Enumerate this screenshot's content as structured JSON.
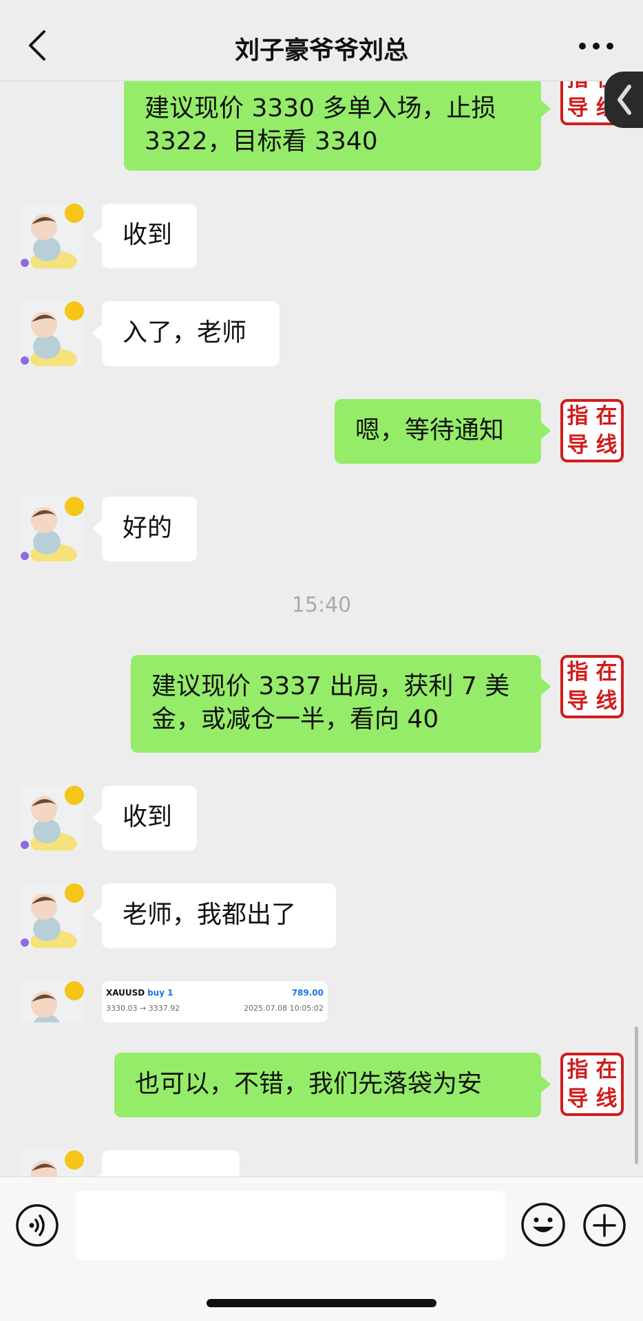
{
  "header": {
    "title": "刘子豪爷爷刘总",
    "back_icon": "chevron-left-icon",
    "more_icon": "ellipsis-icon"
  },
  "stamp": {
    "chars": [
      "指",
      "在",
      "导",
      "线"
    ],
    "color": "#d21a1a"
  },
  "messages": [
    {
      "side": "out",
      "text": "建议现价 3330 多单入场，止损 3322，目标看 3340"
    },
    {
      "side": "in",
      "text": "收到"
    },
    {
      "side": "in",
      "text": "入了，老师"
    },
    {
      "side": "out",
      "text": "嗯，等待通知"
    },
    {
      "side": "in",
      "text": "好的"
    },
    {
      "side": "out",
      "text": "建议现价 3337 出局，获利 7 美金，或减仓一半，看向 40"
    },
    {
      "side": "in",
      "text": "收到"
    },
    {
      "side": "in",
      "text": "老师，我都出了"
    },
    {
      "side": "out",
      "text": "也可以，不错，我们先落袋为安"
    }
  ],
  "timestamp": "15:40",
  "trade_card": {
    "symbol": "XAUUSD",
    "side": "buy 1",
    "profit": "789.00",
    "prices": "3330.03 → 3337.92",
    "datetime": "2025.07.08 10:05:02"
  },
  "bottom_bar": {
    "voice_icon": "voice-icon",
    "emoji_icon": "emoji-icon",
    "plus_icon": "plus-icon",
    "input_value": ""
  },
  "colors": {
    "background": "#ededed",
    "outgoing_bubble": "#95ec69",
    "incoming_bubble": "#ffffff",
    "stamp_red": "#d21a1a"
  }
}
